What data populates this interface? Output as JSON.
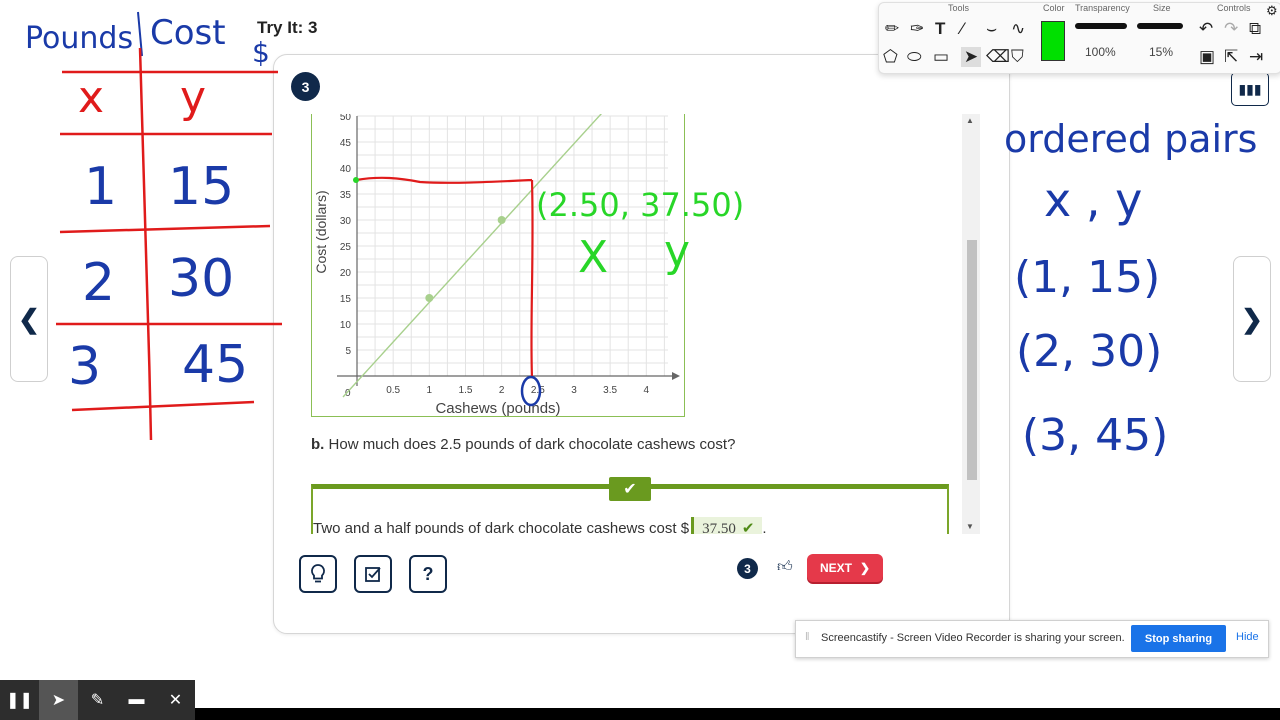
{
  "header": {
    "title": "Try It: 3"
  },
  "question": {
    "number": "3",
    "part_b_label": "b.",
    "part_b_text": "How much does 2.5 pounds of dark chocolate cashews cost?",
    "answer_sentence": "Two and a half pounds of dark chocolate cashews cost $",
    "answer_value": "37.50",
    "answer_end": "."
  },
  "chart_data": {
    "type": "line",
    "xlabel": "Cashews (pounds)",
    "ylabel": "Cost (dollars)",
    "xlim": [
      0,
      4.3
    ],
    "ylim": [
      0,
      50
    ],
    "x_ticks": [
      "0.5",
      "1",
      "1.5",
      "2",
      "2.5",
      "3",
      "3.5",
      "4"
    ],
    "y_ticks": [
      "5",
      "10",
      "15",
      "20",
      "25",
      "30",
      "35",
      "40",
      "45",
      "50"
    ],
    "origin_label": "0",
    "series": [
      {
        "x": [
          0,
          4.3
        ],
        "y": [
          0,
          64.5
        ]
      }
    ],
    "points": [
      {
        "x": 1,
        "y": 15
      },
      {
        "x": 2,
        "y": 30
      }
    ],
    "grid": true,
    "line_color": "#a8d08d"
  },
  "handwritten_table": {
    "header_col1": "Pounds",
    "header_col2": "Cost",
    "dollar": "$",
    "rows": [
      [
        "x",
        "y"
      ],
      [
        "1",
        "15"
      ],
      [
        "2",
        "30"
      ],
      [
        "3",
        "45"
      ]
    ]
  },
  "handwritten_notes": {
    "heading": "ordered pairs",
    "sub": "x , y",
    "pairs": [
      "(1, 15)",
      "(2, 30)",
      "(3, 45)"
    ],
    "chart_annotation": "(2.50, 37.50)",
    "ann_x": "X",
    "ann_y": "y"
  },
  "controls": {
    "tools": [
      {
        "name": "hint",
        "icon": "lightbulb-icon"
      },
      {
        "name": "check",
        "icon": "check-square-icon"
      },
      {
        "name": "help",
        "icon": "question-icon",
        "label": "?"
      }
    ],
    "attempt_count": "3",
    "next_label": "NEXT"
  },
  "annotation_toolbar": {
    "labels": {
      "tools": "Tools",
      "color": "Color",
      "transparency": "Transparency",
      "size": "Size",
      "controls": "Controls"
    },
    "color_value": "#00e000",
    "transparency_value": "100%",
    "size_value": "15%"
  },
  "screen_share": {
    "message": "Screencastify - Screen Video Recorder is sharing your screen.",
    "stop_label": "Stop sharing",
    "hide_label": "Hide"
  },
  "colors": {
    "navy": "#10294a",
    "next_red": "#e5394a",
    "correct_green": "#6a9a1f",
    "ink_blue": "#1a3aa8",
    "ink_red": "#e01b1b",
    "ink_green": "#28d628"
  }
}
